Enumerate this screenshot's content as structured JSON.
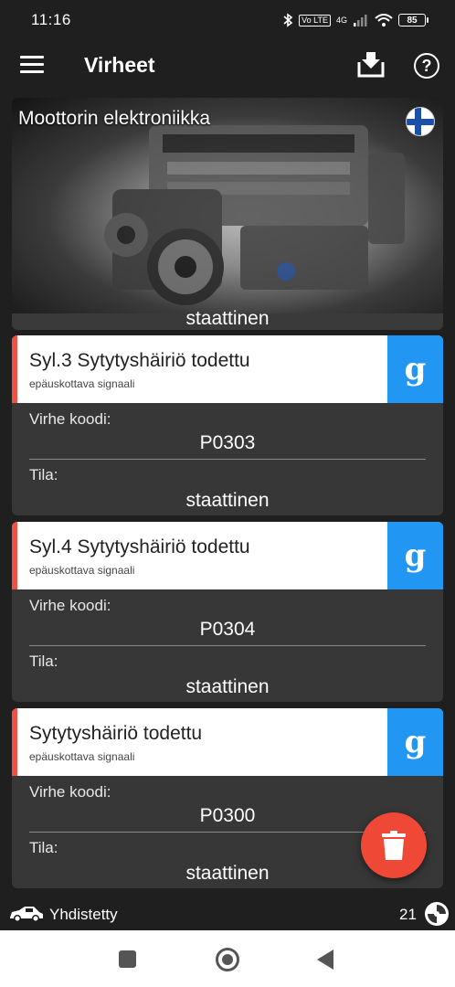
{
  "status_bar": {
    "time": "11:16",
    "volte": "Vo LTE",
    "network": "4G",
    "battery": "85"
  },
  "app_bar": {
    "title": "Virheet"
  },
  "engine_card": {
    "title": "Moottorin elektroniikka",
    "partial_status": "staattinen"
  },
  "faults": [
    {
      "name": "Syl.3 Sytytyshäiriö todettu",
      "subtitle": "epäuskottava signaali",
      "code_label": "Virhe koodi:",
      "code": "P0303",
      "state_label": "Tila:",
      "state": "staattinen",
      "search_glyph": "g"
    },
    {
      "name": "Syl.4 Sytytyshäiriö todettu",
      "subtitle": "epäuskottava signaali",
      "code_label": "Virhe koodi:",
      "code": "P0304",
      "state_label": "Tila:",
      "state": "staattinen",
      "search_glyph": "g"
    },
    {
      "name": "Sytytyshäiriö todettu",
      "subtitle": "epäuskottava signaali",
      "code_label": "Virhe koodi:",
      "code": "P0300",
      "state_label": "Tila:",
      "state": "staattinen",
      "search_glyph": "g"
    }
  ],
  "connection": {
    "status": "Yhdistetty",
    "count": "21"
  },
  "colors": {
    "accent_red": "#f05145",
    "google_blue": "#2196f3",
    "fab_red": "#ef4836",
    "background": "#1f1f1f",
    "card": "#373737"
  },
  "icons": {
    "menu": "menu-icon",
    "download": "download-icon",
    "help": "help-icon",
    "flag": "finland-flag-icon",
    "delete": "trash-icon",
    "car": "car-icon",
    "obd": "obd-adapter-icon"
  }
}
